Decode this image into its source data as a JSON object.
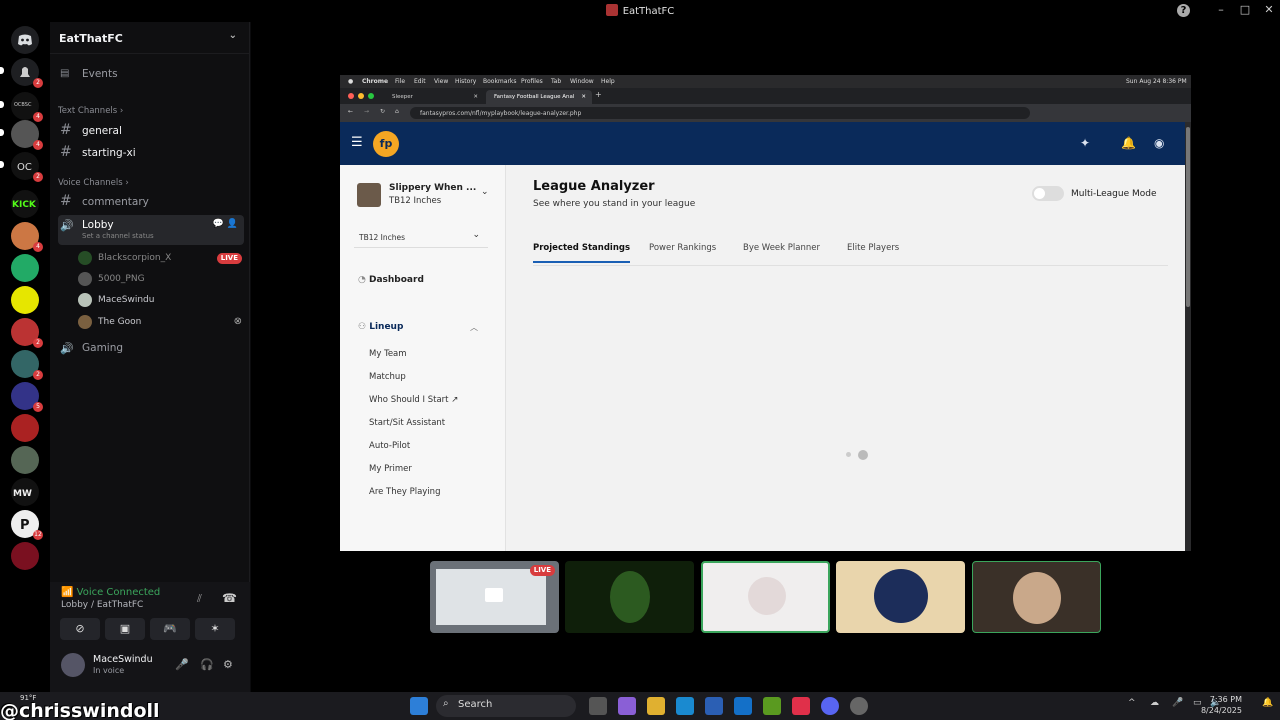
{
  "window": {
    "title": "EatThatFC"
  },
  "server": {
    "name": "EatThatFC"
  },
  "rail_badges": [
    "2",
    "4",
    "4",
    "2",
    "4",
    "2",
    "2",
    "5",
    "12"
  ],
  "channels": {
    "events": "Events",
    "text_category": "Text Channels",
    "general": "general",
    "starting": "starting-xi",
    "voice_category": "Voice Channels",
    "commentary": "commentary",
    "lobby": "Lobby",
    "lobby_status": "Set a channel status",
    "gaming": "Gaming"
  },
  "voice_users": [
    {
      "name": "Blackscorpion_X",
      "live": "LIVE"
    },
    {
      "name": "5000_PNG"
    },
    {
      "name": "MaceSwindu"
    },
    {
      "name": "The Goon"
    }
  ],
  "voice_panel": {
    "status": "Voice Connected",
    "location": "Lobby / EatThatFC",
    "username": "MaceSwindu",
    "user_status": "In voice"
  },
  "mac_menu": [
    "Chrome",
    "File",
    "Edit",
    "View",
    "History",
    "Bookmarks",
    "Profiles",
    "Tab",
    "Window",
    "Help"
  ],
  "mac_clock": "Sun Aug 24 8:36 PM",
  "browser": {
    "tab1": "Sleeper",
    "tab2": "Fantasy Football League Anal",
    "url": "fantasypros.com/nfl/myplaybook/league-analyzer.php"
  },
  "fp": {
    "logo": "fp",
    "team_name": "Slippery When ...",
    "team_sub": "TB12 Inches",
    "league_select": "TB12 Inches",
    "dashboard": "Dashboard",
    "lineup": "Lineup",
    "lineup_items": [
      "My Team",
      "Matchup",
      "Who Should I Start",
      "Start/Sit Assistant",
      "Auto-Pilot",
      "My Primer",
      "Are They Playing"
    ],
    "title": "League Analyzer",
    "subtitle": "See where you stand in your league",
    "toggle_label": "Multi-League Mode",
    "tabs": [
      "Projected Standings",
      "Power Rankings",
      "Bye Week Planner",
      "Elite Players"
    ]
  },
  "thumbnails": {
    "live": "LIVE"
  },
  "taskbar": {
    "search": "Search",
    "weather": "91°F",
    "time": "7:36 PM",
    "date": "8/24/2025"
  },
  "watermark": "@chrisswindoll"
}
